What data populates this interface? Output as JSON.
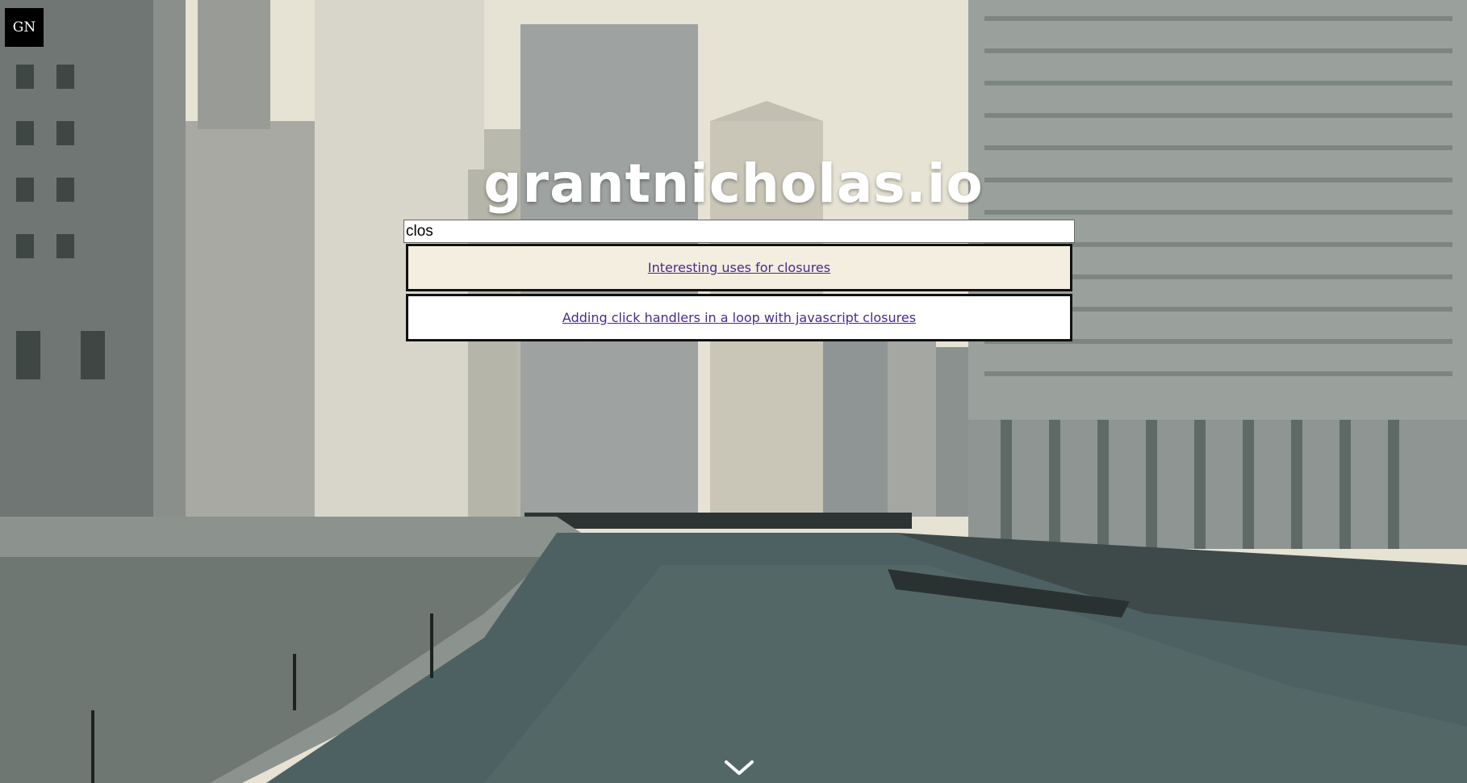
{
  "logo": {
    "text": "GN"
  },
  "title": {
    "text": "grantnicholas.io"
  },
  "search": {
    "value": "clos",
    "placeholder": ""
  },
  "results": [
    {
      "label": "Interesting uses for closures"
    },
    {
      "label": "Adding click handlers in a loop with javascript closures"
    }
  ],
  "icons": {
    "scroll": "chevron-down-icon"
  },
  "colors": {
    "link": "#4b2a8a",
    "badge_bg": "#000000",
    "result_bg_first": "#f3eee0"
  }
}
